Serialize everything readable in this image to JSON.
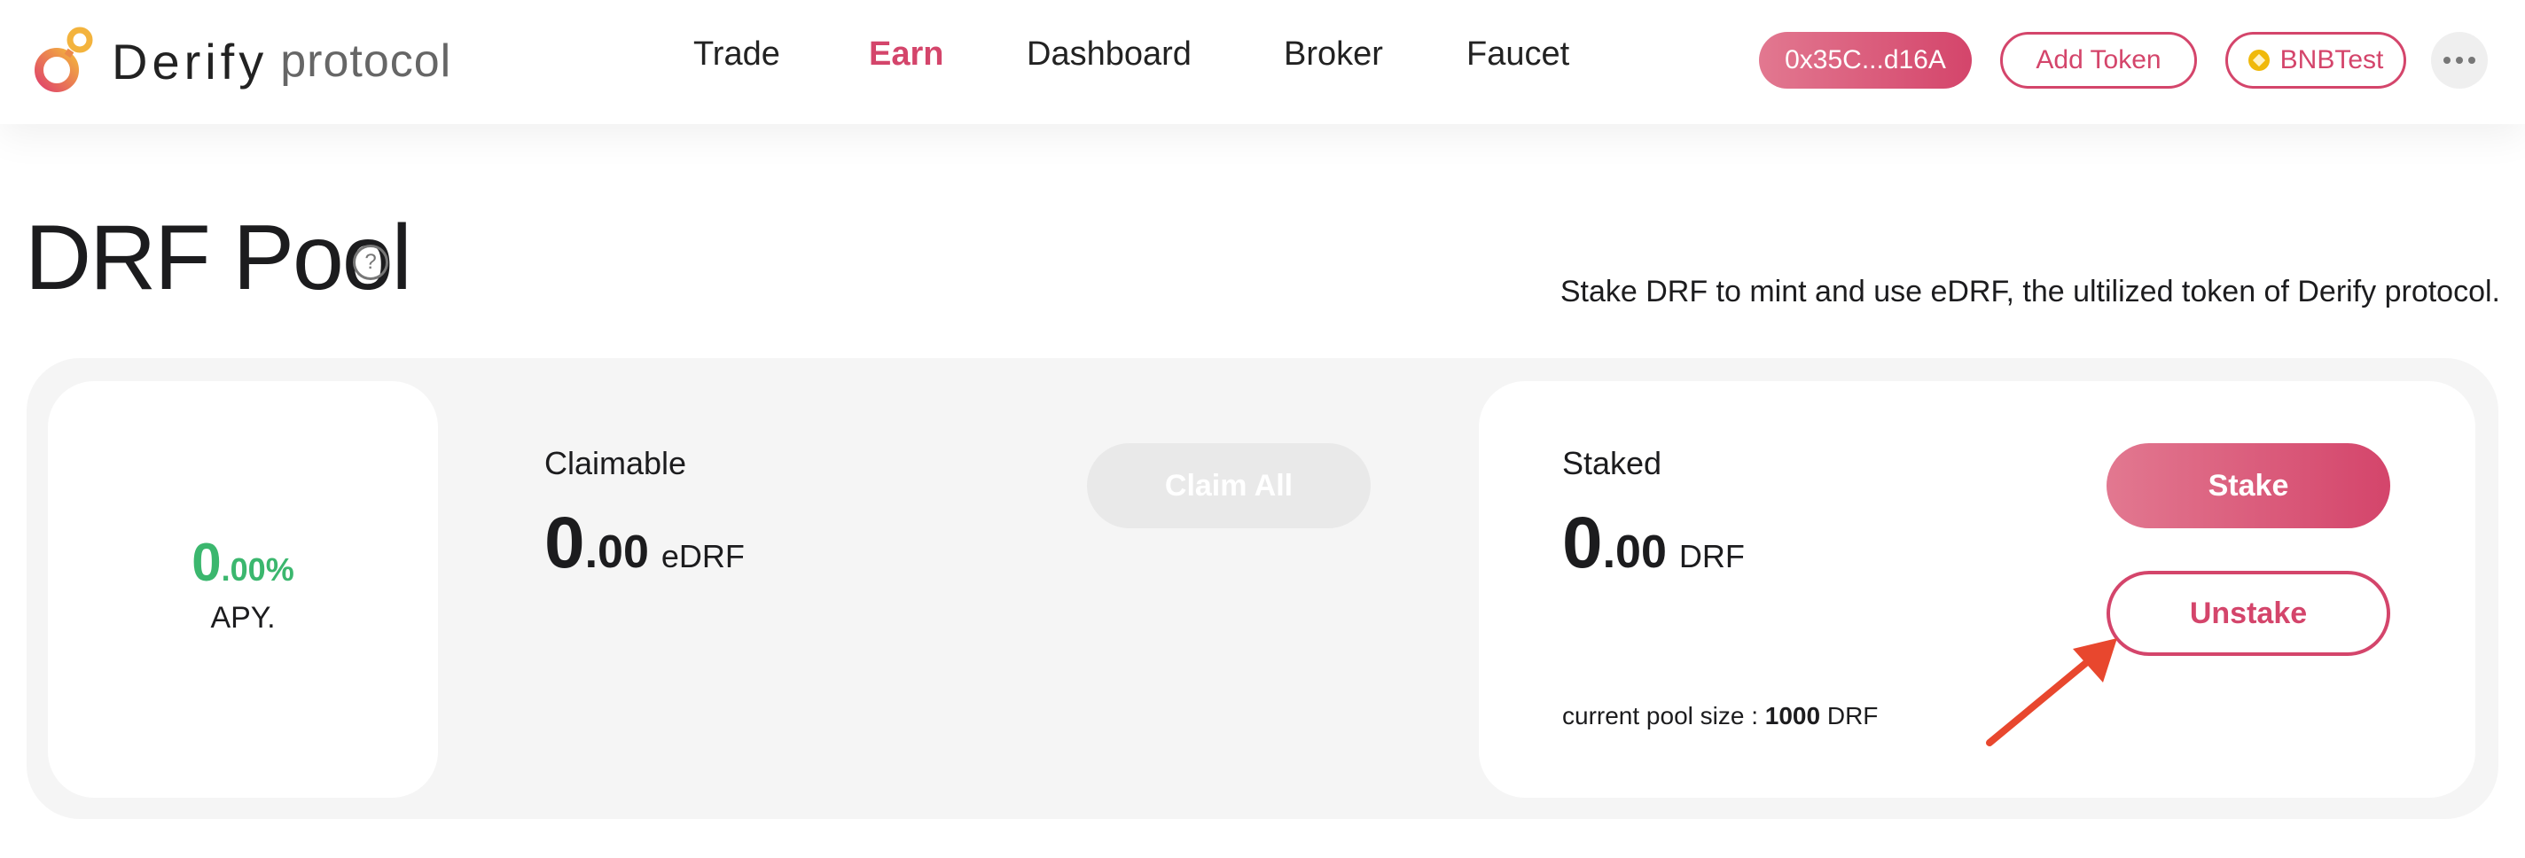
{
  "header": {
    "logo": {
      "brand": "Derify",
      "sub": "protocol"
    },
    "nav": [
      {
        "label": "Trade",
        "active": false
      },
      {
        "label": "Earn",
        "active": true
      },
      {
        "label": "Dashboard",
        "active": false
      },
      {
        "label": "Broker",
        "active": false
      },
      {
        "label": "Faucet",
        "active": false
      }
    ],
    "wallet_address": "0x35C...d16A",
    "add_token_label": "Add Token",
    "network_label": "BNBTest",
    "network_icon": "bnb-coin-icon",
    "more_icon": "more-dots-icon"
  },
  "page": {
    "title": "DRF Pool",
    "help_icon_glyph": "?",
    "subtitle": "Stake DRF to mint and use eDRF, the ultilized token of Derify protocol."
  },
  "apy": {
    "int": "0",
    "dec": ".00%",
    "label": "APY."
  },
  "claimable": {
    "label": "Claimable",
    "int": "0",
    "dec": ".00",
    "unit": "eDRF",
    "claim_all_label": "Claim All"
  },
  "staked": {
    "label": "Staked",
    "int": "0",
    "dec": ".00",
    "unit": "DRF",
    "stake_label": "Stake",
    "unstake_label": "Unstake",
    "pool_size_prefix": "current pool size : ",
    "pool_size_value": "1000",
    "pool_size_unit": " DRF"
  },
  "colors": {
    "accent": "#d4456b",
    "accent_light": "#e27890",
    "apy_green": "#3bb76e",
    "disabled_btn": "#e9e9e9",
    "panel_bg": "#f5f5f5",
    "annotation_arrow": "#e8472e"
  }
}
